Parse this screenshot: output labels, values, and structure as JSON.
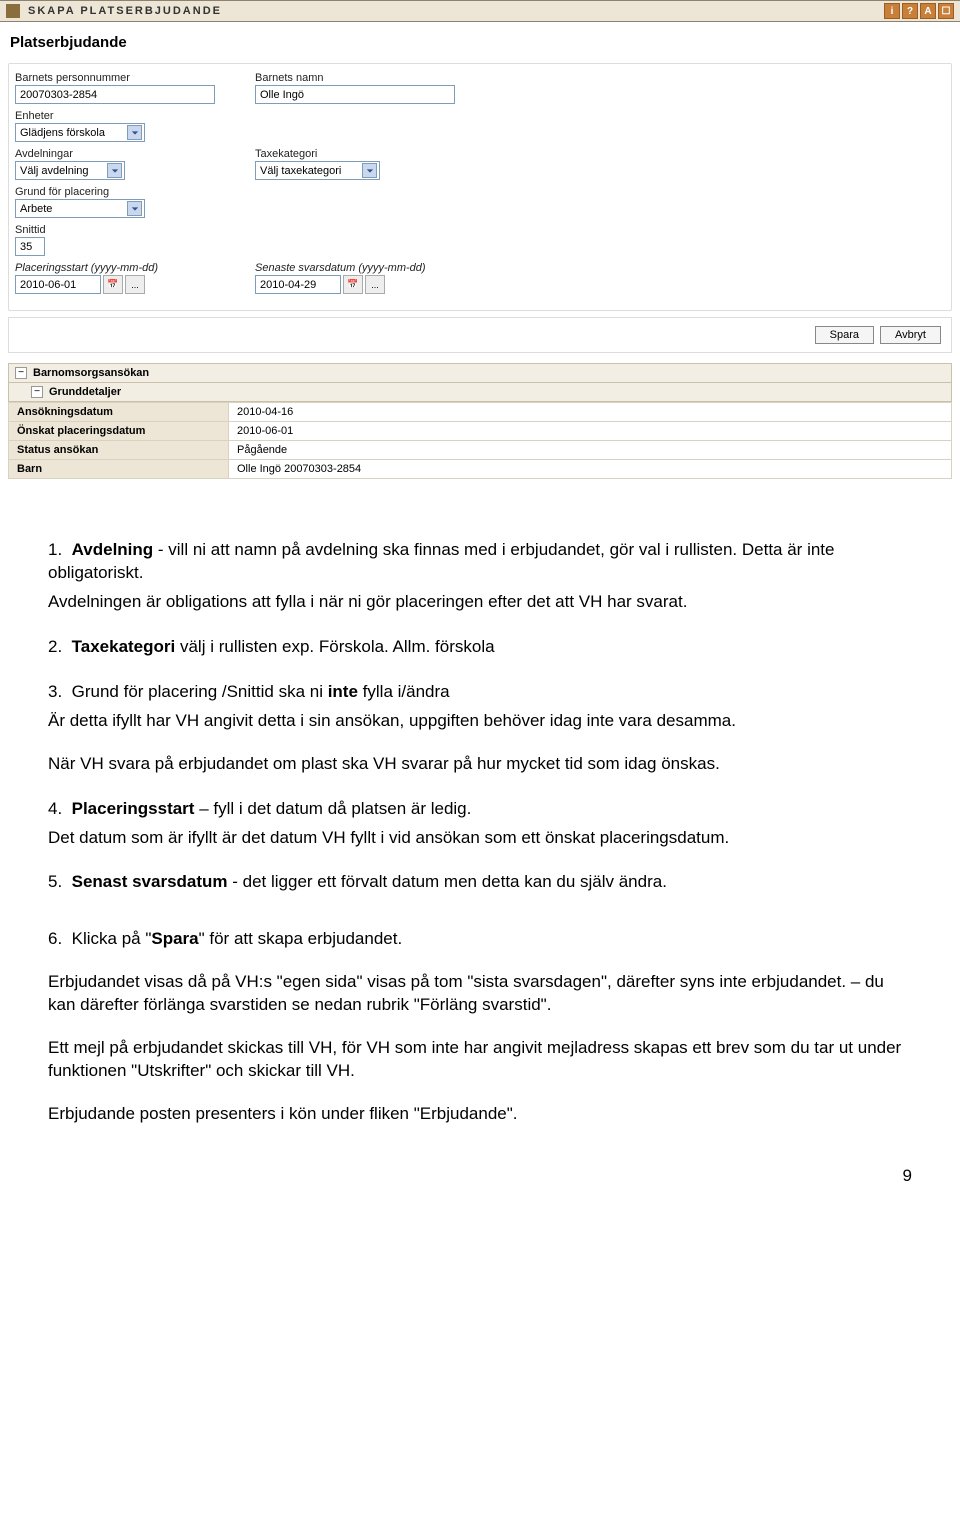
{
  "header": {
    "title": "SKAPA PLATSERBJUDANDE",
    "icons": [
      "i",
      "?",
      "A",
      "☐"
    ]
  },
  "section_title": "Platserbjudande",
  "form": {
    "personnummer_label": "Barnets personnummer",
    "personnummer_value": "20070303-2854",
    "namn_label": "Barnets namn",
    "namn_value": "Olle Ingö",
    "enheter_label": "Enheter",
    "enheter_value": "Glädjens förskola",
    "avdelningar_label": "Avdelningar",
    "avdelningar_value": "Välj avdelning",
    "taxekategori_label": "Taxekategori",
    "taxekategori_value": "Välj taxekategori",
    "grund_label": "Grund för placering",
    "grund_value": "Arbete",
    "snittid_label": "Snittid",
    "snittid_value": "35",
    "placstart_label": "Placeringsstart (yyyy-mm-dd)",
    "placstart_value": "2010-06-01",
    "svarsdatum_label": "Senaste svarsdatum (yyyy-mm-dd)",
    "svarsdatum_value": "2010-04-29",
    "datebtn": "..."
  },
  "buttons": {
    "save": "Spara",
    "cancel": "Avbryt"
  },
  "panel": {
    "title": "Barnomsorgsansökan",
    "subtitle": "Grunddetaljer",
    "rows": [
      {
        "label": "Ansökningsdatum",
        "value": "2010-04-16"
      },
      {
        "label": "Önskat placeringsdatum",
        "value": "2010-06-01"
      },
      {
        "label": "Status ansökan",
        "value": "Pågående"
      },
      {
        "label": "Barn",
        "value": "Olle Ingö 20070303-2854"
      }
    ]
  },
  "doc": {
    "i1_a": "Avdelning",
    "i1_b": " - vill ni att namn på avdelning ska finnas med i erbjudandet, gör val i rullisten. Detta är inte obligatoriskt.",
    "i1_c": "Avdelningen är obligations att fylla i när ni gör placeringen efter det att VH har svarat.",
    "i2_a": "Taxekategori",
    "i2_b": " välj i rullisten exp. Förskola. Allm. förskola",
    "i3_a": "Grund för placering /Snittid ska ni ",
    "i3_b": "inte",
    "i3_c": " fylla i/ändra",
    "i3_d": "Är detta ifyllt har VH angivit detta i sin ansökan, uppgiften behöver idag inte vara desamma.",
    "i3_e": "När VH svara på erbjudandet om plast ska VH svarar på hur mycket tid som idag önskas.",
    "i4_a": "Placeringsstart",
    "i4_b": " – fyll i det datum då platsen är ledig.",
    "i4_c": "Det datum som är ifyllt är det datum VH fyllt i vid ansökan som ett önskat placeringsdatum.",
    "i5_a": "Senast svarsdatum",
    "i5_b": " - det ligger ett förvalt datum men detta kan du själv ändra.",
    "i6_a": "Klicka på \"",
    "i6_b": "Spara",
    "i6_c": "\" för att skapa erbjudandet.",
    "i6_d": "Erbjudandet visas då på VH:s  \"egen sida\" visas på tom \"sista svarsdagen\", därefter syns inte erbjudandet. – du kan därefter förlänga svarstiden se nedan rubrik \"Förläng svarstid\".",
    "i6_e": "Ett mejl på erbjudandet skickas till VH, för VH som inte har angivit mejladress skapas ett brev som du tar ut under funktionen \"Utskrifter\" och skickar till VH.",
    "i6_f": "Erbjudande posten presenters i kön under fliken \"Erbjudande\"."
  },
  "page_number": "9"
}
